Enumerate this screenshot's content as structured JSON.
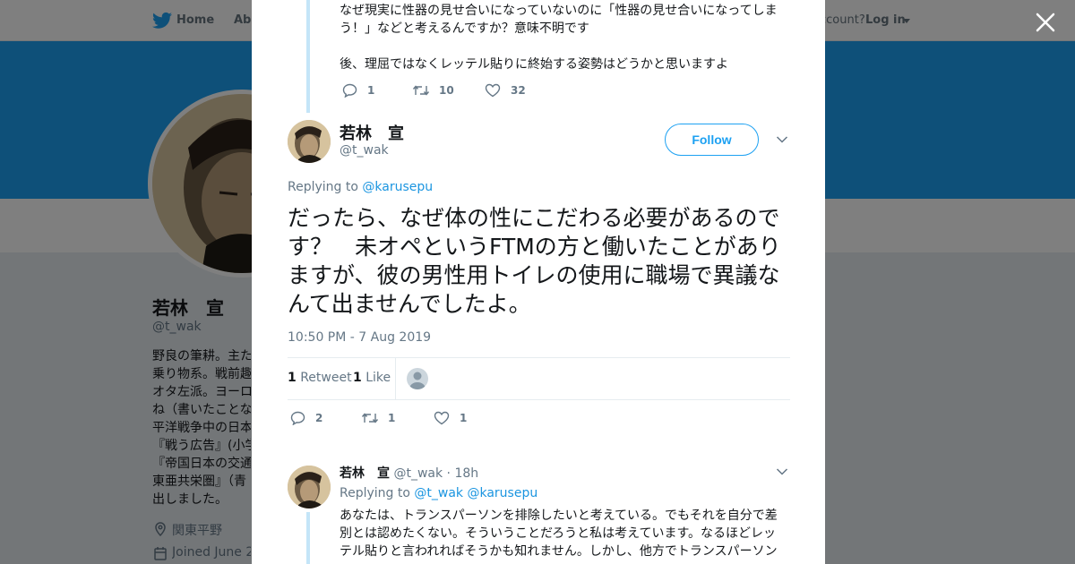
{
  "nav": {
    "home": "Home",
    "about": "Abo",
    "account_prompt": "ccount?",
    "login": "Log in"
  },
  "profile": {
    "name": "若林　宣",
    "handle": "@t_wak",
    "bio": "野良の筆耕。主た\n乗り物系。戦前趣\nオタ左派。ヨーロ\nね（書いたことな\n平洋戦争中の日本\n『戦う広告』(小学\n『帝国日本の交通\n東亜共栄圏』（青\n出しました。",
    "location": "関東平野",
    "joined": "Joined June 2"
  },
  "modal": {
    "prev_tweet": {
      "text": "なぜ現実に性器の見せ合いになっていないのに「性器の見せ合いになってしまう！」などと考えるんですか？意味不明です\n\n後、理屈ではなくレッテル貼りに終始する姿勢はどうかと思いますよ",
      "replies": "1",
      "retweets": "10",
      "likes": "32"
    },
    "main_tweet": {
      "name": "若林　宣",
      "handle": "@t_wak",
      "follow_label": "Follow",
      "replying_prefix": "Replying to",
      "replying_to": "@karusepu",
      "text": "だったら、なぜ体の性にこだわる必要があるのです？　未オペというFTMの方と働いたことがありますが、彼の男性用トイレの使用に職場で異議なんて出ませんでしたよ。",
      "timestamp": "10:50 PM - 7 Aug 2019",
      "retweet_count": "1",
      "retweet_label": "Retweet",
      "like_count": "1",
      "like_label": "Like",
      "replies": "2",
      "retweets": "1",
      "likes": "1"
    },
    "reply_tweet": {
      "name": "若林　宣",
      "handle": "@t_wak",
      "time": "· 18h",
      "replying_prefix": "Replying to",
      "replying_to_1": "@t_wak",
      "replying_to_2": "@karusepu",
      "text": "あなたは、トランスパーソンを排除したいと考えている。でもそれを自分で差別とは認めたくない。そういうことだろうと私は考えています。なるほどレッテル貼りと言われればそうかも知れません。しかし、他方でトランスパーソン"
    }
  },
  "colors": {
    "accent": "#1da1f2",
    "link": "#1b95e0",
    "muted": "#657786",
    "thread_line": "#c4e5f8"
  },
  "icons": [
    "twitter-bird-icon",
    "caret-down-icon",
    "close-icon",
    "reply-icon",
    "retweet-icon",
    "like-icon",
    "location-icon",
    "calendar-icon",
    "chevron-down-icon"
  ]
}
